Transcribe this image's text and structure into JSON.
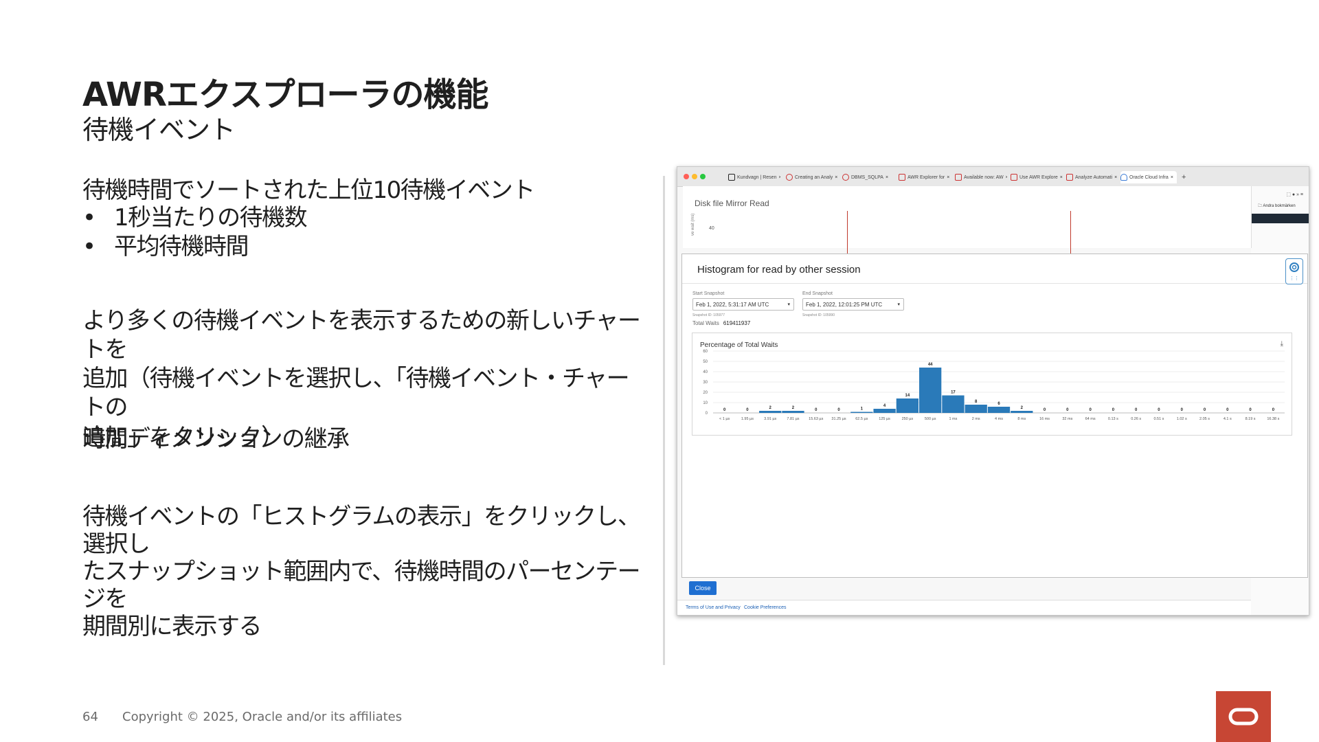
{
  "slide": {
    "title": "AWRエクスプローラの機能",
    "subtitle": "待機イベント",
    "para1": "待機時間でソートされた上位10待機イベント",
    "bullets": [
      "1秒当たりの待機数",
      "平均待機時間"
    ],
    "bullet_char": "•",
    "para2_line1": "より多くの待機イベントを表示するための新しいチャートを",
    "para2_line2": "追加（待機イベントを選択し、「待機イベント・チャートの",
    "para2_line3": "追加」をクリック）",
    "para3": "時間ディメンションの継承",
    "para4_line1": "待機イベントの「ヒストグラムの表示」をクリックし、選択し",
    "para4_line2": "たスナップショット範囲内で、待機時間のパーセンテージを",
    "para4_line3": "期間別に表示する",
    "page_number": "64",
    "copyright": "Copyright © 2025, Oracle and/or its affiliates",
    "brand_color": "#c74634"
  },
  "browser": {
    "tabs": [
      {
        "label": "Kundvagn | Resen"
      },
      {
        "label": "Creating an Analy"
      },
      {
        "label": "DBMS_SQLPA"
      },
      {
        "label": "AWR Explorer for"
      },
      {
        "label": "Available now: AW"
      },
      {
        "label": "Use AWR Explore"
      },
      {
        "label": "Analyze Automati"
      },
      {
        "label": "Oracle Cloud Infra"
      }
    ],
    "tab_close": "×",
    "new_tab": "+",
    "bookmarks": "Andra bokmärken"
  },
  "background_panel": {
    "title": "Disk file Mirror Read",
    "y_label": "ve wait (ms)",
    "y_tick": "40"
  },
  "modal": {
    "title": "Histogram for read by other session",
    "start_label": "Start Snapshot",
    "start_value": "Feb 1, 2022, 5:31:17 AM UTC",
    "start_id": "Snapshot ID: 105977",
    "end_label": "End Snapshot",
    "end_value": "Feb 1, 2022, 12:01:25 PM UTC",
    "end_id": "Snapshot ID: 105990",
    "total_label": "Total Waits",
    "total_value": "619411937",
    "close_label": "Close",
    "download_icon": "download-icon"
  },
  "footer_links": {
    "terms": "Terms of Use and Privacy",
    "cookies": "Cookie Preferences"
  },
  "chart_data": {
    "type": "bar",
    "title": "Percentage of Total Waits",
    "categories": [
      "< 1 µs",
      "1.95 µs",
      "3.91 µs",
      "7.81 µs",
      "15.63 µs",
      "31.25 µs",
      "62.5 µs",
      "125 µs",
      "250 µs",
      "500 µs",
      "1 ms",
      "2 ms",
      "4 ms",
      "8 ms",
      "16 ms",
      "32 ms",
      "64 ms",
      "0.13 s",
      "0.26 s",
      "0.51 s",
      "1.02 s",
      "2.05 s",
      "4.1 s",
      "8.19 s",
      "16.38 s"
    ],
    "values": [
      0,
      0,
      2,
      2,
      0,
      0,
      1,
      4,
      14,
      44,
      17,
      8,
      6,
      2,
      0,
      0,
      0,
      0,
      0,
      0,
      0,
      0,
      0,
      0,
      0
    ],
    "yticks": [
      0,
      10,
      20,
      30,
      40,
      50,
      60
    ],
    "ylim": [
      0,
      60
    ],
    "bar_color": "#2a7ab9"
  }
}
